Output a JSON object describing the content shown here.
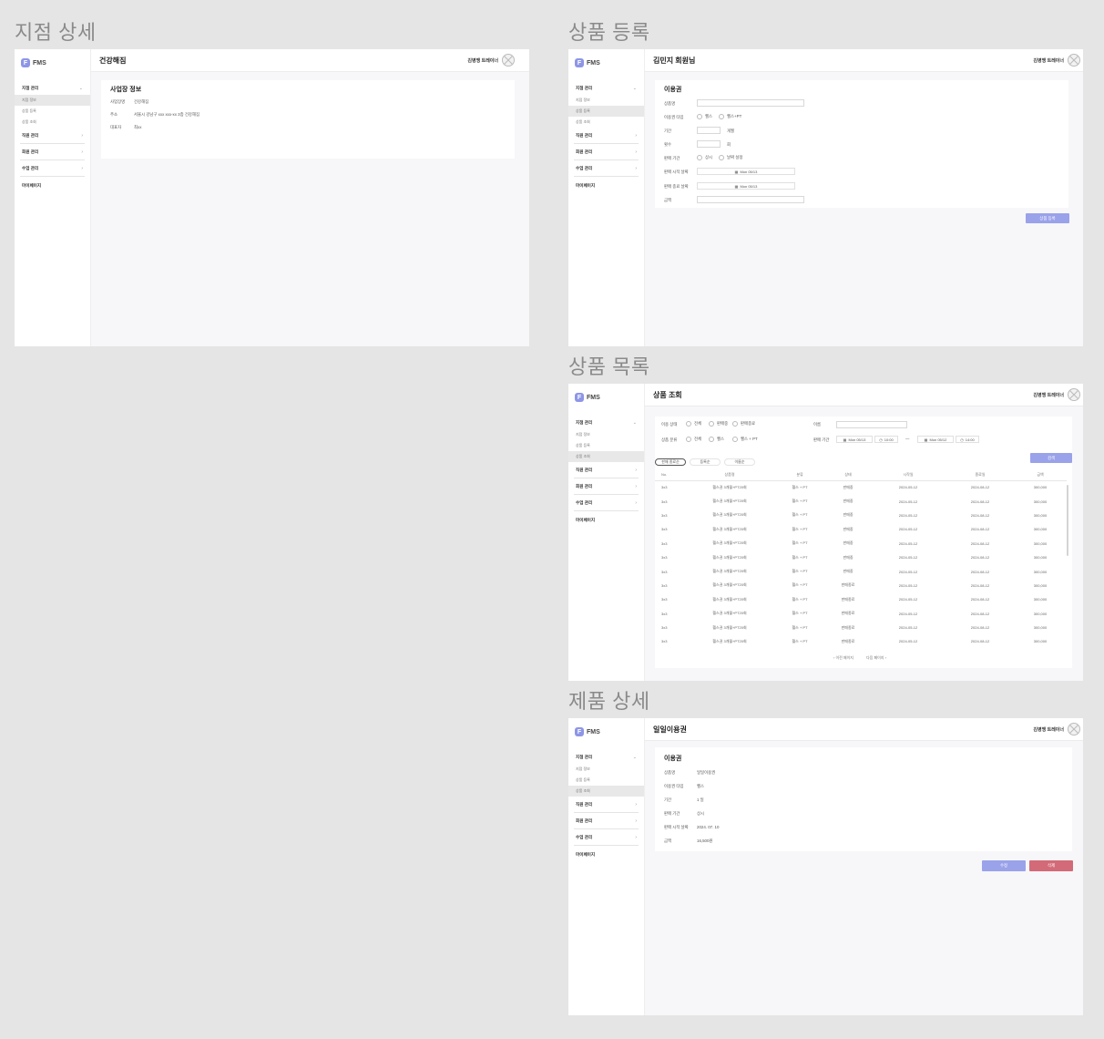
{
  "sections": {
    "branch_detail": "지점 상세",
    "product_register": "상품 등록",
    "product_list": "상품 목록",
    "product_detail": "제품 상세"
  },
  "app": {
    "logo_letter": "F",
    "logo_text": "FMS",
    "user_name": "김병맹 트레이너"
  },
  "sidebar": {
    "group_label": "지점 관리",
    "sub_items": [
      "지점 정보",
      "상품 등록",
      "상품 조회"
    ],
    "items": [
      "직원 관리",
      "회원 관리",
      "수업 관리"
    ],
    "mypage": "마이페이지"
  },
  "branch": {
    "page_title": "건강해짐",
    "card_title": "사업장 정보",
    "rows": [
      {
        "label": "사업장명",
        "value": "건강해짐"
      },
      {
        "label": "주소",
        "value": "서울시 강남구 xxx xxx-xx 3층 건강해짐"
      },
      {
        "label": "대표자",
        "value": "최xx"
      }
    ]
  },
  "register": {
    "page_title": "김민지 회원님",
    "card_title": "이용권",
    "labels": {
      "name": "상품명",
      "type": "이용권 타입",
      "period": "기간",
      "count": "횟수",
      "sale_period": "판매 기간",
      "sale_start": "판매 시작 날짜",
      "sale_end": "판매 종료 날짜",
      "price": "금액"
    },
    "type_options": [
      "헬스",
      "헬스+PT"
    ],
    "period_unit": "개월",
    "count_unit": "회",
    "sale_period_options": [
      "상시",
      "날짜 설정"
    ],
    "start_date": "Mon 05/13",
    "end_date": "Mon 05/13",
    "submit": "상품 등록"
  },
  "list": {
    "page_title": "상품 조회",
    "filters": {
      "sale_status_label": "이용 상태",
      "sale_status_options": [
        "전체",
        "판매중",
        "판매종료"
      ],
      "type_label": "상품 분류",
      "type_options": [
        "전체",
        "헬스",
        "헬스 + PT"
      ],
      "name_label": "이름",
      "period_label": "판매 기간",
      "from_date": "Mon 05/13",
      "from_time": "10:00",
      "to_date": "Mon 05/12",
      "to_time": "14:00",
      "dash": "—",
      "search": "검색"
    },
    "sort_pills": [
      "판매 종료순",
      "등록순",
      "이름순"
    ],
    "columns": [
      "No.",
      "상품명",
      "분류",
      "상태",
      "시작일",
      "종료일",
      "금액"
    ],
    "rows": [
      [
        "3x3",
        "헬스권 3개월+PT20회",
        "헬스 + PT",
        "판매중",
        "2024-05-12",
        "2024-08-12",
        "300,000"
      ],
      [
        "3x3",
        "헬스권 3개월+PT20회",
        "헬스 + PT",
        "판매중",
        "2024-05-12",
        "2024-08-12",
        "300,000"
      ],
      [
        "3x3",
        "헬스권 3개월+PT20회",
        "헬스 + PT",
        "판매중",
        "2024-05-12",
        "2024-08-12",
        "300,000"
      ],
      [
        "3x3",
        "헬스권 3개월+PT20회",
        "헬스 + PT",
        "판매중",
        "2024-05-12",
        "2024-08-12",
        "300,000"
      ],
      [
        "3x3",
        "헬스권 3개월+PT20회",
        "헬스 + PT",
        "판매중",
        "2024-05-12",
        "2024-08-12",
        "300,000"
      ],
      [
        "3x3",
        "헬스권 3개월+PT20회",
        "헬스 + PT",
        "판매중",
        "2024-05-12",
        "2024-08-12",
        "300,000"
      ],
      [
        "3x3",
        "헬스권 3개월+PT20회",
        "헬스 + PT",
        "판매중",
        "2024-05-12",
        "2024-08-12",
        "300,000"
      ],
      [
        "3x3",
        "헬스권 3개월+PT20회",
        "헬스 + PT",
        "판매종료",
        "2024-05-12",
        "2024-08-12",
        "300,000"
      ],
      [
        "3x3",
        "헬스권 3개월+PT20회",
        "헬스 + PT",
        "판매종료",
        "2024-05-12",
        "2024-08-12",
        "300,000"
      ],
      [
        "3x3",
        "헬스권 3개월+PT20회",
        "헬스 + PT",
        "판매종료",
        "2024-05-12",
        "2024-08-12",
        "300,000"
      ],
      [
        "3x3",
        "헬스권 3개월+PT20회",
        "헬스 + PT",
        "판매종료",
        "2024-05-12",
        "2024-08-12",
        "300,000"
      ],
      [
        "3x3",
        "헬스권 3개월+PT20회",
        "헬스 + PT",
        "판매종료",
        "2024-05-12",
        "2024-08-12",
        "300,000"
      ]
    ],
    "prev": "이전 페이지",
    "next": "다음 페이지"
  },
  "detail": {
    "page_title": "일일이용권",
    "card_title": "이용권",
    "rows": [
      {
        "label": "상품명",
        "value": "일일이용권"
      },
      {
        "label": "이용권 타입",
        "value": "헬스"
      },
      {
        "label": "기간",
        "value": "1 일"
      },
      {
        "label": "판매 기간",
        "value": "상시"
      },
      {
        "label": "판매 시작 날짜",
        "value": "2024. 07. 10"
      },
      {
        "label": "금액",
        "value": "16,500원"
      }
    ],
    "edit": "수정",
    "delete": "삭제"
  },
  "colors": {
    "accent": "#9aa2ea",
    "danger": "#d36a78",
    "canvas": "#e5e5e5"
  }
}
